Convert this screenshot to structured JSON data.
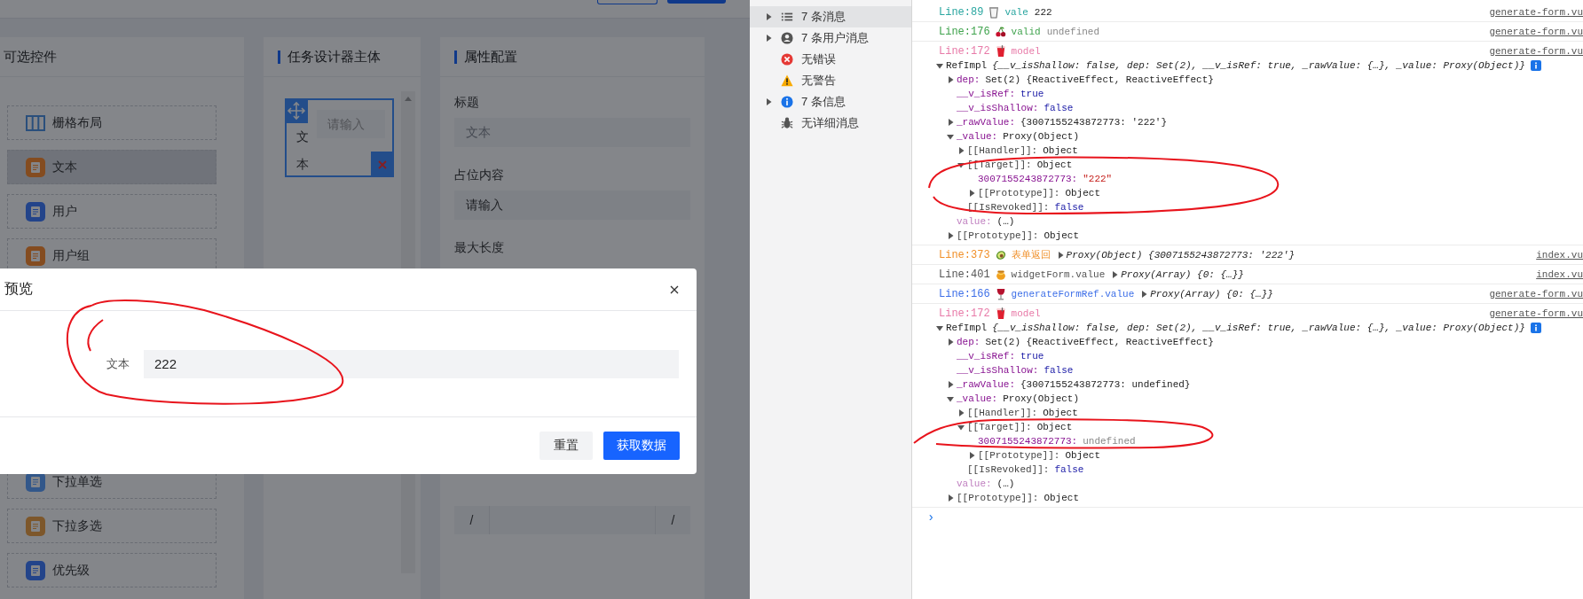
{
  "app": {
    "palette": {
      "title": "可选控件",
      "items": [
        {
          "label": "栅格布局",
          "kind": "grid",
          "selected": false
        },
        {
          "label": "文本",
          "kind": "badge",
          "selected": true
        },
        {
          "label": "用户",
          "kind": "badge",
          "selected": false
        },
        {
          "label": "用户组",
          "kind": "badge",
          "selected": false
        }
      ],
      "more_items": [
        {
          "label": "下拉单选",
          "kind": "badge",
          "selected": false
        },
        {
          "label": "下拉多选",
          "kind": "badge",
          "selected": false
        },
        {
          "label": "优先级",
          "kind": "badge",
          "selected": false
        }
      ]
    },
    "designer": {
      "title": "任务设计器主体",
      "widget": {
        "label": "文本",
        "placeholder": "请输入",
        "selected": true
      }
    },
    "properties": {
      "title": "属性配置",
      "fields": [
        {
          "label": "标题",
          "placeholder": "文本"
        },
        {
          "label": "占位内容",
          "value": "请输入"
        },
        {
          "label": "最大长度"
        }
      ],
      "range_field": {
        "prefix": "/",
        "suffix": "/"
      }
    }
  },
  "modal": {
    "title": "预览",
    "field": {
      "label": "文本",
      "value": "222"
    },
    "buttons": [
      {
        "label": "重置",
        "kind": "default"
      },
      {
        "label": "获取数据",
        "kind": "primary"
      }
    ]
  },
  "devtools": {
    "sidebar": [
      {
        "label": "7 条消息",
        "kind": "list",
        "expanded": false,
        "selected": true
      },
      {
        "label": "7 条用户消息",
        "kind": "user",
        "expanded": false,
        "selected": false
      },
      {
        "label": "无错误",
        "kind": "error",
        "selected": false
      },
      {
        "label": "无警告",
        "kind": "warning",
        "selected": false
      },
      {
        "label": "7 条信息",
        "kind": "info",
        "expanded": false,
        "selected": false
      },
      {
        "label": "无详细消息",
        "kind": "verbose",
        "selected": false
      }
    ],
    "console": [
      {
        "line": "Line:89",
        "kind": "cup",
        "color": "#2aa6a0",
        "label": "vale",
        "value": {
          "text": "222",
          "kind": "plain"
        },
        "source": "generate-form.vu"
      },
      {
        "line": "Line:176",
        "kind": "cherries",
        "color": "#3fa34d",
        "label": "valid",
        "value": {
          "text": "undefined",
          "kind": "undefined"
        },
        "source": "generate-form.vu"
      },
      {
        "line": "Line:172",
        "kind": "red-cup",
        "color": "#e87aa8",
        "label": "model",
        "source": "generate-form.vu",
        "tree": {
          "key": "RefImpl",
          "value": {
            "text": "{__v_isShallow: false, dep: Set(2), __v_isRef: true, _rawValue: {…}, _value: Proxy(Object)}",
            "kind": "preview"
          },
          "info": true,
          "expanded": true,
          "children": [
            {
              "key": "dep:",
              "kind": "property",
              "value": {
                "text": "Set(2) {ReactiveEffect, ReactiveEffect}",
                "kind": "object"
              },
              "expanded": false
            },
            {
              "key": "__v_isRef:",
              "kind": "property",
              "value": {
                "text": "true",
                "kind": "keyword"
              }
            },
            {
              "key": "__v_isShallow:",
              "kind": "property",
              "value": {
                "text": "false",
                "kind": "keyword"
              }
            },
            {
              "key": "_rawValue:",
              "kind": "property",
              "value": {
                "text": "{3007155243872773: '222'}",
                "kind": "object"
              },
              "expanded": false
            },
            {
              "key": "_value:",
              "kind": "property",
              "value": {
                "text": "Proxy(Object)",
                "kind": "object"
              },
              "expanded": true,
              "children": [
                {
                  "key": "[[Handler]]:",
                  "kind": "internal",
                  "value": {
                    "text": "Object",
                    "kind": "object"
                  },
                  "expanded": false
                },
                {
                  "key": "[[Target]]:",
                  "kind": "internal",
                  "value": {
                    "text": "Object",
                    "kind": "object"
                  },
                  "expanded": true,
                  "children": [
                    {
                      "key": "3007155243872773:",
                      "kind": "property",
                      "value": {
                        "text": "\"222\"",
                        "kind": "string"
                      }
                    },
                    {
                      "key": "[[Prototype]]:",
                      "kind": "internal",
                      "value": {
                        "text": "Object",
                        "kind": "object"
                      },
                      "expanded": false
                    }
                  ]
                },
                {
                  "key": "[[IsRevoked]]:",
                  "kind": "internal",
                  "value": {
                    "text": "false",
                    "kind": "keyword"
                  }
                }
              ]
            },
            {
              "key": "value:",
              "kind": "accessor",
              "value": {
                "text": "(…)",
                "kind": "object"
              }
            },
            {
              "key": "[[Prototype]]:",
              "kind": "internal",
              "value": {
                "text": "Object",
                "kind": "object"
              },
              "expanded": false
            }
          ]
        }
      },
      {
        "line": "Line:373",
        "kind": "avocado",
        "color": "#f0902a",
        "label": "表单返回",
        "value": {
          "text": "Proxy(Object) {3007155243872773: '222'}",
          "kind": "object",
          "expanded": false
        },
        "source": "index.vu"
      },
      {
        "line": "Line:401",
        "kind": "honey-pot",
        "color": "#555555",
        "label": "widgetForm.value",
        "value": {
          "text": "Proxy(Array) {0: {…}}",
          "kind": "object",
          "expanded": false
        },
        "source": "index.vu"
      },
      {
        "line": "Line:166",
        "kind": "wine-glass",
        "color": "#3d6fe8",
        "label": "generateFormRef.value",
        "value": {
          "text": "Proxy(Array) {0: {…}}",
          "kind": "object",
          "expanded": false
        },
        "source": "generate-form.vu"
      },
      {
        "line": "Line:172",
        "kind": "red-cup",
        "color": "#e87aa8",
        "label": "model",
        "source": "generate-form.vu",
        "tree": {
          "key": "RefImpl",
          "value": {
            "text": "{__v_isShallow: false, dep: Set(2), __v_isRef: true, _rawValue: {…}, _value: Proxy(Object)}",
            "kind": "preview"
          },
          "info": true,
          "expanded": true,
          "children": [
            {
              "key": "dep:",
              "kind": "property",
              "value": {
                "text": "Set(2) {ReactiveEffect, ReactiveEffect}",
                "kind": "object"
              },
              "expanded": false
            },
            {
              "key": "__v_isRef:",
              "kind": "property",
              "value": {
                "text": "true",
                "kind": "keyword"
              }
            },
            {
              "key": "__v_isShallow:",
              "kind": "property",
              "value": {
                "text": "false",
                "kind": "keyword"
              }
            },
            {
              "key": "_rawValue:",
              "kind": "property",
              "value": {
                "text": "{3007155243872773: undefined}",
                "kind": "object"
              },
              "expanded": false
            },
            {
              "key": "_value:",
              "kind": "property",
              "value": {
                "text": "Proxy(Object)",
                "kind": "object"
              },
              "expanded": true,
              "children": [
                {
                  "key": "[[Handler]]:",
                  "kind": "internal",
                  "value": {
                    "text": "Object",
                    "kind": "object"
                  },
                  "expanded": false
                },
                {
                  "key": "[[Target]]:",
                  "kind": "internal",
                  "value": {
                    "text": "Object",
                    "kind": "object"
                  },
                  "expanded": true,
                  "children": [
                    {
                      "key": "3007155243872773:",
                      "kind": "property",
                      "value": {
                        "text": "undefined",
                        "kind": "undefined"
                      }
                    },
                    {
                      "key": "[[Prototype]]:",
                      "kind": "internal",
                      "value": {
                        "text": "Object",
                        "kind": "object"
                      },
                      "expanded": false
                    }
                  ]
                },
                {
                  "key": "[[IsRevoked]]:",
                  "kind": "internal",
                  "value": {
                    "text": "false",
                    "kind": "keyword"
                  }
                }
              ]
            },
            {
              "key": "value:",
              "kind": "accessor",
              "value": {
                "text": "(…)",
                "kind": "object"
              }
            },
            {
              "key": "[[Prototype]]:",
              "kind": "internal",
              "value": {
                "text": "Object",
                "kind": "object"
              },
              "expanded": false
            }
          ]
        }
      }
    ],
    "prompt": "›"
  }
}
